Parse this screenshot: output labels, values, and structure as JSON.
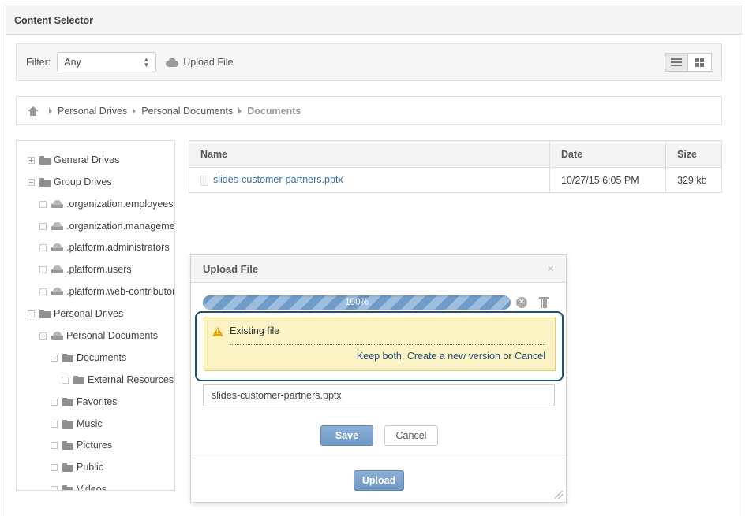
{
  "window": {
    "title": "Content Selector"
  },
  "filter": {
    "label": "Filter:",
    "selected": "Any",
    "upload_label": "Upload File"
  },
  "breadcrumb": {
    "items": [
      "Personal Drives",
      "Personal Documents"
    ],
    "current": "Documents"
  },
  "tree": {
    "items": [
      "General Drives",
      "Group Drives",
      ".organization.employees",
      ".organization.management",
      ".platform.administrators",
      ".platform.users",
      ".platform.web-contributors",
      "Personal Drives",
      "Personal Documents",
      "Documents",
      "External Resources",
      "Favorites",
      "Music",
      "Pictures",
      "Public",
      "Videos"
    ]
  },
  "table": {
    "headers": [
      "Name",
      "Date",
      "Size"
    ],
    "rows": [
      {
        "name": "slides-customer-partners.pptx",
        "date": "10/27/15 6:05 PM",
        "size": "329 kb"
      }
    ]
  },
  "dialog": {
    "title": "Upload File",
    "close": "×",
    "progress_text": "100%",
    "progress_value": 1.0,
    "warning": {
      "title": "Existing file",
      "keep_both": "Keep both",
      "new_version": "Create a new version",
      "or": "or",
      "cancel": "Cancel",
      "comma": ","
    },
    "filename": "slides-customer-partners.pptx",
    "save_label": "Save",
    "cancel_label": "Cancel",
    "upload_label": "Upload"
  },
  "colors": {
    "accent": "#6f98c4",
    "link": "#3a6fa3",
    "warning_bg": "#fbf3c4",
    "highlight_border": "#1f4e79"
  }
}
